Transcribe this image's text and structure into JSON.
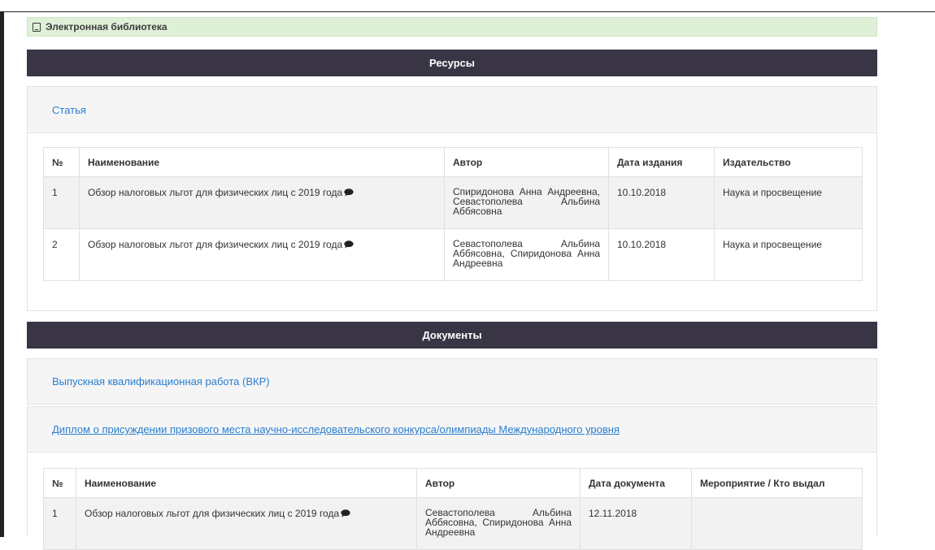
{
  "library": {
    "title": "Электронная библиотека"
  },
  "resources": {
    "section_title": "Ресурсы",
    "category_link": "Статья",
    "columns": [
      "№",
      "Наименование",
      "Автор",
      "Дата издания",
      "Издательство"
    ],
    "rows": [
      {
        "num": "1",
        "title": "Обзор налоговых льгот для физических лиц с 2019 года",
        "author": "Спиридонова Анна Андреевна, Севастополева Альбина Аббясовна",
        "date": "10.10.2018",
        "publisher": "Наука и просвещение"
      },
      {
        "num": "2",
        "title": "Обзор налоговых льгот для физических лиц с 2019 года",
        "author": "Севастополева Альбина Аббясовна, Спиридонова Анна Андреевна",
        "date": "10.10.2018",
        "publisher": "Наука и просвещение"
      }
    ]
  },
  "documents": {
    "section_title": "Документы",
    "category_link_1": "Выпускная квалификационная работа (ВКР)",
    "category_link_2": "Диплом о присуждении призового места научно-исследовательского конкурса/олимпиады Международного уровня",
    "columns": [
      "№",
      "Наименование",
      "Автор",
      "Дата документа",
      "Мероприятие / Кто выдал"
    ],
    "rows": [
      {
        "num": "1",
        "title": "Обзор налоговых льгот для физических лиц с 2019 года",
        "author": "Севастополева Альбина Аббясовна, Спиридонова Анна Андреевна",
        "date": "12.11.2018",
        "event": ""
      }
    ]
  },
  "colors": {
    "section_bar": "#393545",
    "link": "#2a7ecf",
    "library_bg": "#dff0d8"
  }
}
